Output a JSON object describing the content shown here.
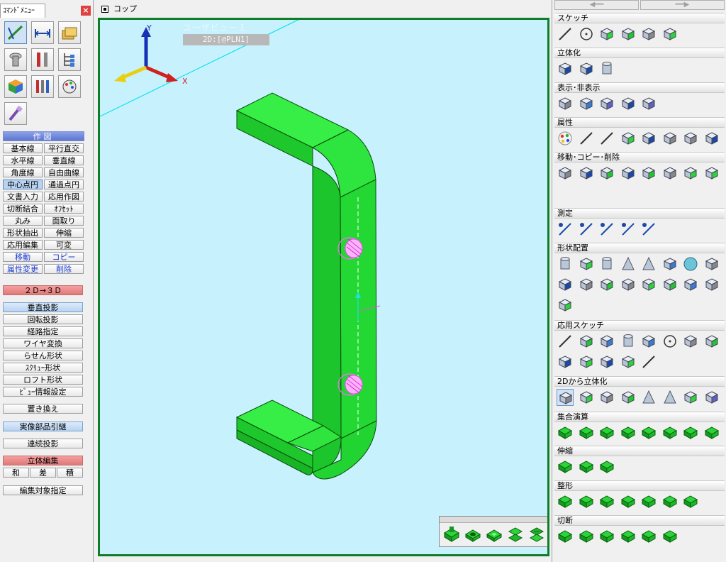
{
  "left_panel": {
    "title": "ｺﾏﾝﾄﾞﾒﾆｭｰ",
    "close_label": "×",
    "icons": [
      "sketch-tool-icon",
      "dimension-icon",
      "folder-stack-icon",
      "bolt-icon",
      "tools-icon",
      "tree-icon",
      "cube-icon",
      "toolbox-icon",
      "palette-tool-icon",
      "paint-roller-icon"
    ],
    "draw_header": "作図",
    "commands": [
      [
        "基本線",
        "平行直交"
      ],
      [
        "水平線",
        "垂直線"
      ],
      [
        "角度線",
        "自由曲線"
      ],
      [
        "中心点円",
        "通過点円"
      ],
      [
        "文書入力",
        "応用作図"
      ],
      [
        "切断結合",
        "ｵﾌｾｯﾄ"
      ],
      [
        "丸み",
        "面取り"
      ],
      [
        "形状抽出",
        "伸縮"
      ],
      [
        "応用編集",
        "可変"
      ],
      [
        "移動",
        "コピー"
      ],
      [
        "属性変更",
        "削除"
      ]
    ],
    "conv_header": "２Ｄ→３Ｄ",
    "solid_commands": [
      "垂直投影",
      "回転投影",
      "経路指定",
      "ワイヤ変換",
      "らせん形状",
      "ｽｸﾘｭｰ形状",
      "ロフト形状",
      "ﾋﾞｭｰ情報設定"
    ],
    "replace_label": "置き換え",
    "real_parts_label": "実像部品引継",
    "continuous_label": "連続投影",
    "solid_edit_header": "立体編集",
    "bool_ops": [
      "和",
      "差",
      "積"
    ],
    "edit_target_label": "編集対象指定"
  },
  "viewport": {
    "window_title": "コップ",
    "view_name": "ユーザビュー１",
    "plane_label": "2D:[@PLN1]",
    "axis_x": "X",
    "axis_y": "Y",
    "colors": {
      "background": "#c7f2fd",
      "model": "#22dd33",
      "border": "#0d7d2a"
    }
  },
  "quickbar": {
    "icons": [
      "union-icon",
      "subtract-icon",
      "intersect-icon",
      "stack-icon",
      "stack-alt-icon"
    ]
  },
  "right_panel": {
    "sections": [
      {
        "title": "スケッチ",
        "icons": [
          "line-icon",
          "circle-icon",
          "arc-icon",
          "curve-icon",
          "spline-icon",
          "eraser-icon"
        ]
      },
      {
        "title": "立体化",
        "icons": [
          "extrude-icon",
          "extrude-both-icon",
          "cylinder-extrude-icon"
        ]
      },
      {
        "title": "表示･非表示",
        "icons": [
          "show-icon",
          "dim-show-icon",
          "hide-icon",
          "group-hide-icon",
          "dim-hide-icon"
        ]
      },
      {
        "title": "属性",
        "icons": [
          "color-icon",
          "linetype-icon",
          "lineweight-icon",
          "wire-box-icon",
          "box-icon",
          "layer-icon",
          "solid-attr-icon",
          "surface-attr-icon"
        ]
      },
      {
        "title": "移動･コピー･削除",
        "icons": [
          "move-icon",
          "rotate-icon",
          "mirror-icon",
          "copy-icon",
          "multi-copy-icon",
          "rotate-copy-icon",
          "mirror-copy-icon",
          "scale-copy-icon",
          "delete-icon"
        ]
      },
      {
        "title": "測定",
        "icons": [
          "measure-point-icon",
          "measure-length-icon",
          "measure-distance-icon",
          "measure-angle-icon",
          "measure-volume-icon"
        ]
      },
      {
        "title": "形状配置",
        "icons": [
          "cylinder-icon",
          "slab-icon",
          "tube-icon",
          "cone-icon",
          "frustum-icon",
          "ring-icon",
          "sphere-icon",
          "ellipsoid-icon",
          "dome-icon",
          "gear-icon",
          "spring-icon",
          "nut-icon",
          "pipe-icon",
          "gear-plate-icon",
          "gear-plate-2-icon",
          "gear-plate-3-icon",
          "gear-plate-4-icon",
          "gear-lock-icon",
          "gear-search-icon"
        ]
      },
      {
        "title": "応用スケッチ",
        "icons": [
          "line-offset-icon",
          "tangent-icon",
          "rounded-icon",
          "cylinder-sketch-icon",
          "hatch-icon",
          "point-icon",
          "wave-icon",
          "polygon-icon",
          "trim-icon",
          "snap-icon",
          "fillet-sketch-icon",
          "chamfer-sketch-icon",
          "multi-icon",
          "slash-icon"
        ]
      },
      {
        "title": "2Dから立体化",
        "icons": [
          "extrude-2d-icon",
          "revolve-2d-icon",
          "sweep-2d-icon",
          "sweep-curve-icon",
          "pyramid-icon",
          "loft-cone-icon",
          "helix-icon",
          "screw-icon"
        ]
      },
      {
        "title": "集合演算",
        "icons": [
          "bool-union-icon",
          "bool-subtract-icon",
          "bool-intersect-icon",
          "bool-stack-icon",
          "bool-stack-alt-icon",
          "bool-split-icon",
          "bool-push-icon",
          "bool-push-alt-icon"
        ]
      },
      {
        "title": "伸縮",
        "icons": [
          "stretch-icon",
          "stretch-face-icon",
          "stretch-both-icon"
        ]
      },
      {
        "title": "整形",
        "icons": [
          "shape-1-icon",
          "shape-2-icon",
          "shape-3-icon",
          "shape-4-icon",
          "shape-5-icon",
          "shape-6-icon",
          "shape-7-icon"
        ]
      },
      {
        "title": "切断",
        "icons": [
          "cut-1-icon",
          "cut-2-icon",
          "cut-3-icon",
          "cut-4-icon",
          "cut-5-icon",
          "cut-6-icon"
        ]
      }
    ]
  }
}
